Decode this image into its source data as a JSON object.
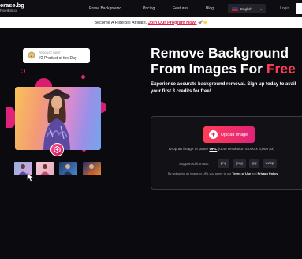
{
  "nav": {
    "logo_title": "erase.bg",
    "logo_sub": "PixelBin.io",
    "items": [
      {
        "label": "Erase Background",
        "has_dropdown": true
      },
      {
        "label": "Pricing",
        "has_dropdown": false
      },
      {
        "label": "Features",
        "has_dropdown": false
      },
      {
        "label": "Blog",
        "has_dropdown": false
      }
    ],
    "language": "English",
    "login": "Login"
  },
  "banner": {
    "text": "Become A PixelBin Affiliate.",
    "link": "Join Our Program Now!",
    "emoji": "🚀⭐"
  },
  "badge": {
    "top": "PRODUCT HUNT",
    "title": "#2 Product of the Day"
  },
  "hero": {
    "title_line1": "Remove Background",
    "title_line2_prefix": "From Images For ",
    "title_line2_accent": "Free",
    "subtitle_line1": "Experience accurate background removal. Sign up today to avail",
    "subtitle_line2": "your first 3 credits for free!"
  },
  "upload": {
    "button": "Upload Image",
    "drop_prefix": "Drop an image or paste ",
    "drop_url": "URL",
    "drop_suffix": " (upto resolution 5,000 x 5,000 px)",
    "formats_label": "Supported formats:",
    "formats": [
      "png",
      "jpeg",
      "jpg",
      "webp"
    ],
    "terms_prefix": "By uploading an image or URL you agree to our ",
    "terms_link": "Terms of Use",
    "terms_mid": " and ",
    "privacy_link": "Privacy Policy."
  },
  "colors": {
    "accent": "#ff3b5c",
    "background": "#0b0b0f",
    "button_gradient": [
      "#ff3d57",
      "#e0237a"
    ]
  }
}
